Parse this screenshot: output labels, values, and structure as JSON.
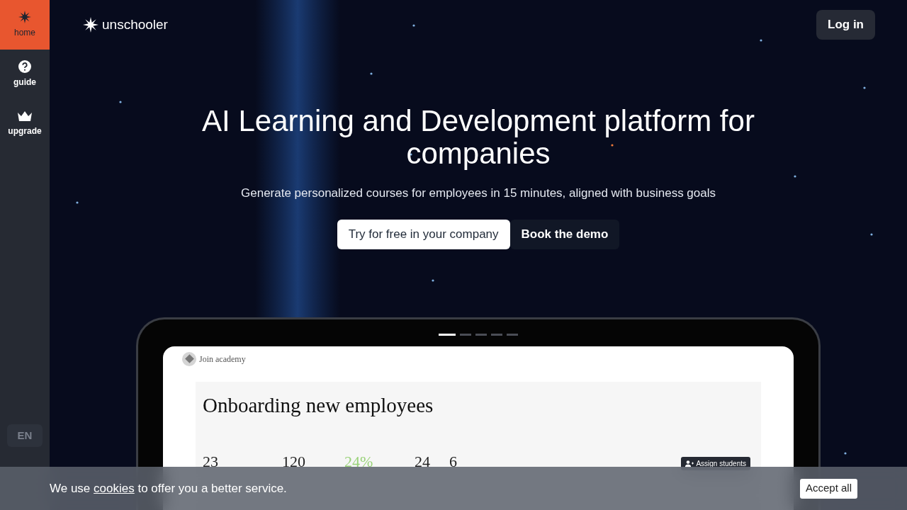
{
  "sidebar": {
    "items": [
      {
        "label": "home",
        "selected": true
      },
      {
        "label": "guide",
        "selected": false
      },
      {
        "label": "upgrade",
        "selected": false
      }
    ],
    "language_button": {
      "label": "EN",
      "disabled": true
    }
  },
  "header": {
    "logo": "unschooler",
    "login_button": "Log in"
  },
  "hero": {
    "title": "AI Learning and Development platform for companies",
    "subtitle": "Generate personalized courses for employees in 15 minutes, aligned with business goals",
    "buttons": [
      {
        "label": "Try for free in your company",
        "kind": "primary"
      },
      {
        "label": "Book the demo",
        "kind": "secondary"
      }
    ]
  },
  "preview": {
    "carousel": [
      {
        "selected": true
      },
      {
        "selected": false
      },
      {
        "selected": false
      },
      {
        "selected": false
      },
      {
        "selected": false
      }
    ],
    "academy_link": "Join academy",
    "course_title": "Onboarding new employees",
    "stats": [
      {
        "value": "23",
        "highlighted": false
      },
      {
        "value": "120",
        "highlighted": false
      },
      {
        "value": "24%",
        "highlighted": true
      },
      {
        "value": "24",
        "highlighted": false
      },
      {
        "value": "6",
        "highlighted": false
      }
    ],
    "assign_button": "Assign students"
  },
  "cookie_banner": {
    "text_before": "We use ",
    "link": "cookies",
    "text_after": " to offer you a better service.",
    "accept_button": "Accept all"
  }
}
